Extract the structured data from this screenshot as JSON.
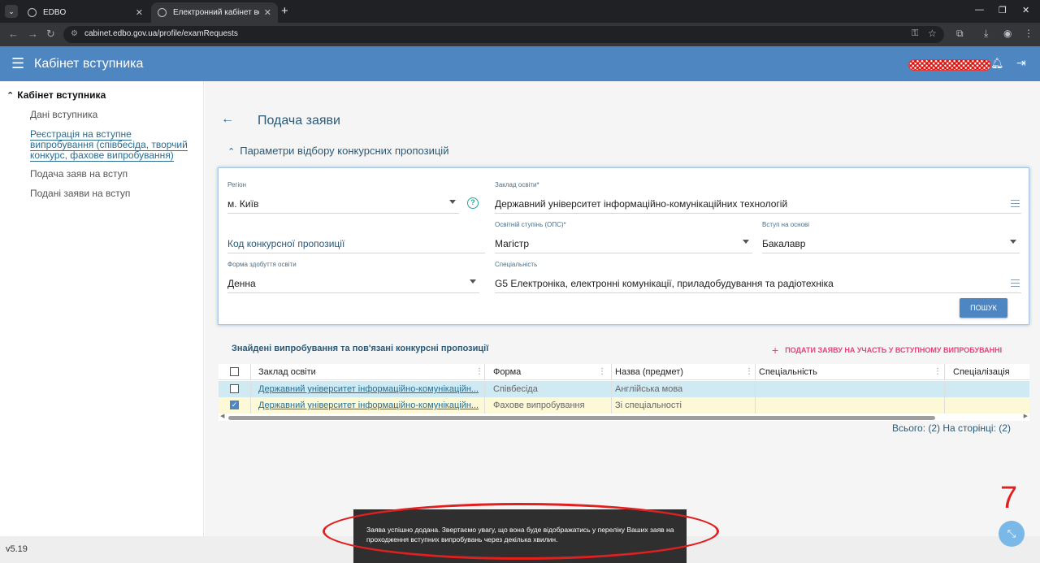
{
  "browser": {
    "tabs": [
      {
        "title": "EDBO"
      },
      {
        "title": "Електронний кабінет вступник"
      }
    ],
    "url": "cabinet.edbo.gov.ua/profile/examRequests"
  },
  "header": {
    "title": "Кабінет вступника"
  },
  "sidebar": {
    "heading": "Кабінет вступника",
    "items": [
      {
        "label": "Дані вступника"
      },
      {
        "label": "Реєстрація на вступне випробування (співбесіда, творчий конкурс, фахове випробування)",
        "active": true
      },
      {
        "label": "Подача заяв на вступ"
      },
      {
        "label": "Подані заяви на вступ"
      }
    ]
  },
  "version": "v5.19",
  "page": {
    "title": "Подача заяви",
    "section_title": "Параметри відбору конкурсних пропозицій"
  },
  "filters": {
    "region": {
      "label": "Регіон",
      "value": "м. Київ"
    },
    "institution": {
      "label": "Заклад освіти*",
      "value": "Державний університет інформаційно-комунікаційних технологій"
    },
    "offer_code": {
      "placeholder": "Код конкурсної пропозиції"
    },
    "degree": {
      "label": "Освітній ступінь (ОПС)*",
      "value": "Магістр"
    },
    "basis": {
      "label": "Вступ на основі",
      "value": "Бакалавр"
    },
    "study_form": {
      "label": "Форма здобуття освіти",
      "value": "Денна"
    },
    "specialty": {
      "label": "Спеціальність",
      "value": "G5 Електроніка, електронні комунікації, приладобудування та радіотехніка"
    },
    "search_label": "ПОШУК"
  },
  "results": {
    "title": "Знайдені випробування та пов'язані конкурсні пропозиції",
    "apply_label": "ПОДАТИ ЗАЯВУ НА УЧАСТЬ У ВСТУПНОМУ ВИПРОБУВАННІ",
    "columns": [
      "Заклад освіти",
      "Форма",
      "Назва (предмет)",
      "Спеціальність",
      "Спеціалізація"
    ],
    "rows": [
      {
        "institution": "Державний університет інформаційно-комунікаційн...",
        "form": "Співбесіда",
        "subject": "Англійська мова",
        "specialty": "",
        "specialization": "",
        "checked": false
      },
      {
        "institution": "Державний університет інформаційно-комунікаційн...",
        "form": "Фахове випробування",
        "subject": "Зі спеціальності",
        "specialty": "",
        "specialization": "",
        "checked": true
      }
    ],
    "pager": "Всього: (2) На сторінці: (2)"
  },
  "toast": {
    "message": "Заява успішно додана. Звертаємо увагу, що вона буде відображатись у переліку Ваших заяв на проходження вступних випробувань через декілька хвилин."
  },
  "annotation": {
    "number": "7",
    "color": "#e02020"
  },
  "colors": {
    "header": "#4d86c0",
    "accent_link": "#2a6d8f",
    "apply_pink": "#e0457b",
    "row_selected_blue": "#cfeaf2",
    "row_selected_yellow": "#fdf8d5"
  }
}
